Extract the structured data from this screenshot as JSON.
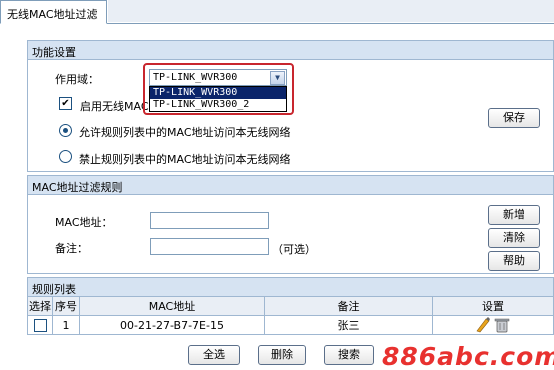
{
  "tab": {
    "title": "无线MAC地址过滤"
  },
  "function_section": {
    "header": "功能设置",
    "scope_label": "作用域：",
    "scope_value": "TP-LINK_WVR300",
    "scope_options": [
      "TP-LINK_WVR300",
      "TP-LINK_WVR300_2"
    ],
    "enable_label": "启用无线MAC地址过滤",
    "enable_checked": true,
    "allow_label": "允许规则列表中的MAC地址访问本无线网络",
    "deny_label": "禁止规则列表中的MAC地址访问本无线网络",
    "selected_mode": "allow",
    "save_label": "保存"
  },
  "rule_section": {
    "header": "MAC地址过滤规则",
    "mac_label": "MAC地址：",
    "mac_value": "",
    "note_label": "备注：",
    "note_value": "",
    "optional_hint": "（可选）",
    "add_label": "新增",
    "clear_label": "清除",
    "help_label": "帮助"
  },
  "rule_list": {
    "header": "规则列表",
    "columns": [
      "选择",
      "序号",
      "MAC地址",
      "备注",
      "设置"
    ],
    "rows": [
      {
        "selected": false,
        "index": "1",
        "mac": "00-21-27-B7-7E-15",
        "note": "张三"
      }
    ],
    "select_all_label": "全选",
    "delete_label": "删除",
    "search_label": "搜索"
  },
  "watermark": {
    "text": "886abc.com"
  },
  "colors": {
    "section_header_bg": "#d6e3f2",
    "highlight_border": "#c8262e",
    "selected_option_bg": "#0a246a"
  }
}
